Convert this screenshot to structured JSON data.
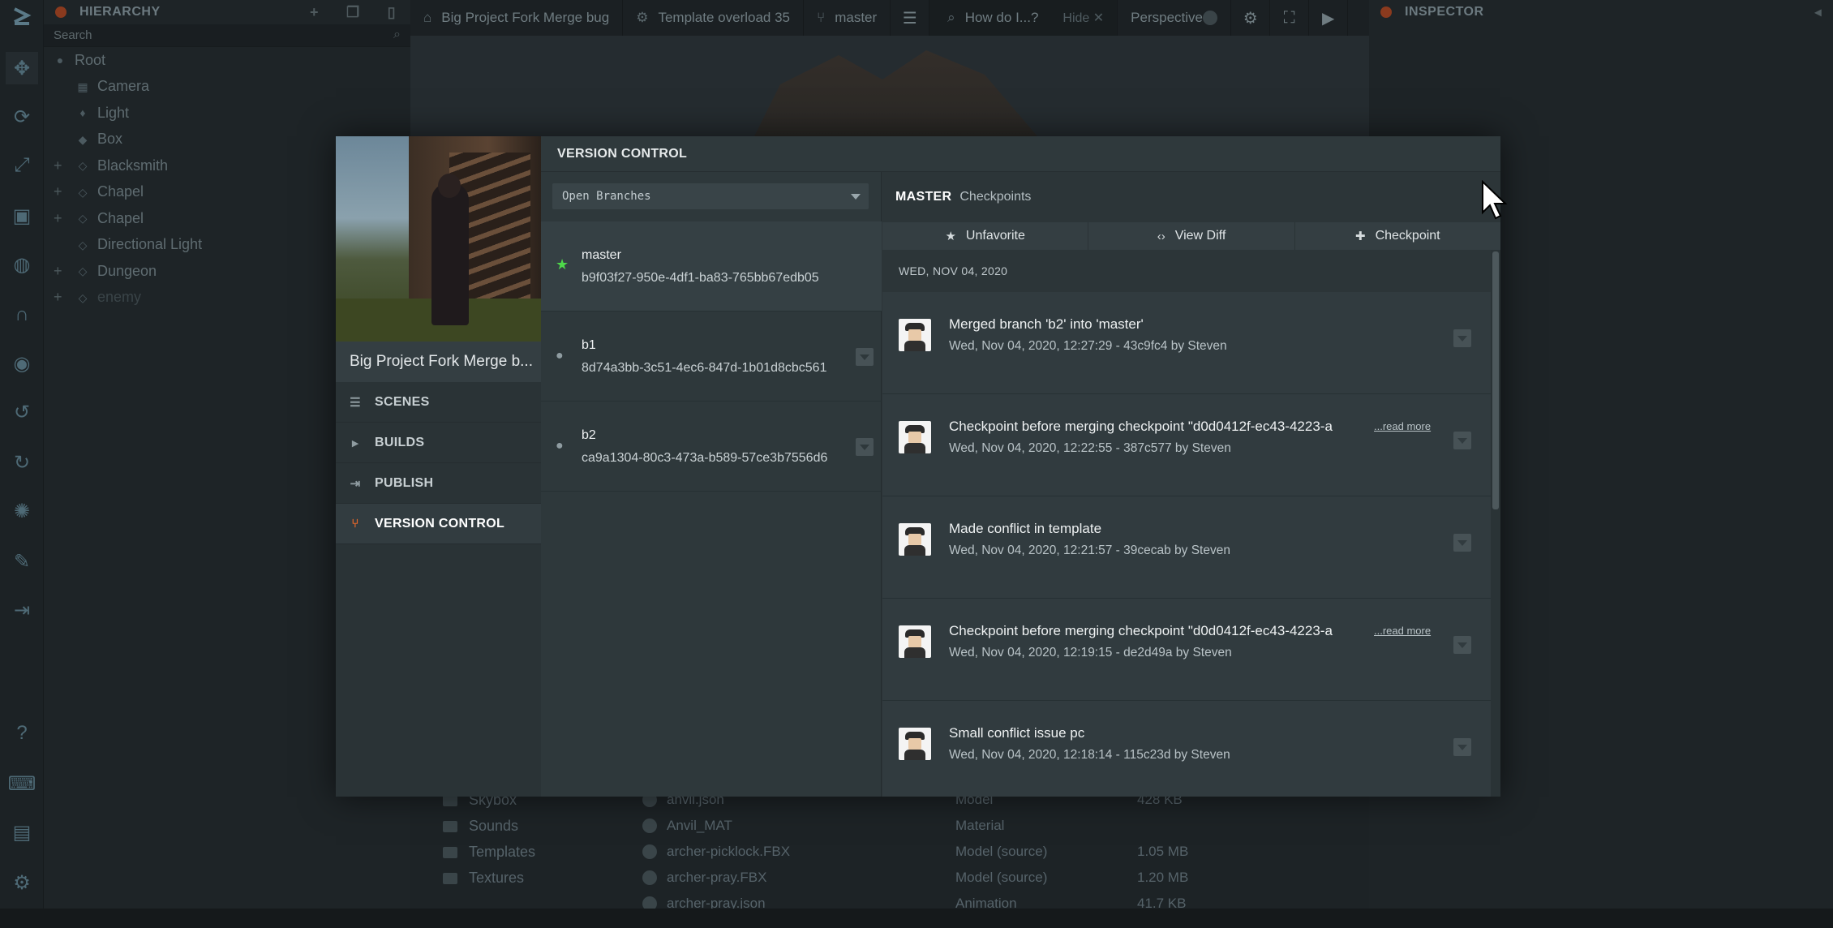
{
  "hierarchy": {
    "title": "HIERARCHY",
    "search_placeholder": "Search",
    "items": [
      {
        "label": "Root"
      },
      {
        "label": "Camera"
      },
      {
        "label": "Light"
      },
      {
        "label": "Box"
      },
      {
        "label": "Blacksmith"
      },
      {
        "label": "Chapel"
      },
      {
        "label": "Chapel"
      },
      {
        "label": "Directional Light"
      },
      {
        "label": "Dungeon"
      },
      {
        "label": "enemy"
      }
    ]
  },
  "tabs": {
    "project": "Big Project Fork Merge bug",
    "template": "Template overload 35",
    "branch": "master",
    "search_placeholder": "How do I...?",
    "hide": "Hide",
    "perspective": "Perspective"
  },
  "inspector": {
    "title": "INSPECTOR"
  },
  "assets": {
    "folders": [
      "Skybox",
      "Sounds",
      "Templates",
      "Textures"
    ],
    "files": [
      {
        "name": "anvil.json",
        "type": "Model",
        "size": "428 KB"
      },
      {
        "name": "Anvil_MAT",
        "type": "Material",
        "size": ""
      },
      {
        "name": "archer-picklock.FBX",
        "type": "Model (source)",
        "size": "1.05 MB"
      },
      {
        "name": "archer-pray.FBX",
        "type": "Model (source)",
        "size": "1.20 MB"
      },
      {
        "name": "archer-pray.json",
        "type": "Animation",
        "size": "41.7 KB"
      }
    ]
  },
  "modal": {
    "project_name": "Big Project Fork Merge b...",
    "nav": [
      {
        "label": "SCENES",
        "icon": "list-icon"
      },
      {
        "label": "BUILDS",
        "icon": "play-icon"
      },
      {
        "label": "PUBLISH",
        "icon": "publish-icon"
      },
      {
        "label": "VERSION CONTROL",
        "icon": "branch-icon"
      }
    ],
    "title": "VERSION CONTROL",
    "branch_filter": "Open Branches",
    "branches": [
      {
        "name": "master",
        "hash": "b9f03f27-950e-4df1-ba83-765bb67edb05"
      },
      {
        "name": "b1",
        "hash": "8d74a3bb-3c51-4ec6-847d-1b01d8cbc561"
      },
      {
        "name": "b2",
        "hash": "ca9a1304-80c3-473a-b589-57ce3b7556d6"
      }
    ],
    "current_branch": "MASTER",
    "checkpoints_label": "Checkpoints",
    "actions": {
      "unfavorite": "Unfavorite",
      "view_diff": "View Diff",
      "checkpoint": "Checkpoint"
    },
    "date_header": "WED, NOV 04, 2020",
    "read_more": "...read more",
    "commits": [
      {
        "message": "Merged branch 'b2' into 'master'",
        "meta": "Wed, Nov 04, 2020, 12:27:29 - 43c9fc4 by Steven",
        "read_more": false
      },
      {
        "message": "Checkpoint before merging checkpoint \"d0d0412f-ec43-4223-a",
        "meta": "Wed, Nov 04, 2020, 12:22:55 - 387c577 by Steven",
        "read_more": true
      },
      {
        "message": "Made conflict in template",
        "meta": "Wed, Nov 04, 2020, 12:21:57 - 39cecab by Steven",
        "read_more": false
      },
      {
        "message": "Checkpoint before merging checkpoint \"d0d0412f-ec43-4223-a",
        "meta": "Wed, Nov 04, 2020, 12:19:15 - de2d49a by Steven",
        "read_more": true
      },
      {
        "message": "Small conflict issue pc",
        "meta": "Wed, Nov 04, 2020, 12:18:14 - 115c23d by Steven",
        "read_more": false
      }
    ]
  }
}
